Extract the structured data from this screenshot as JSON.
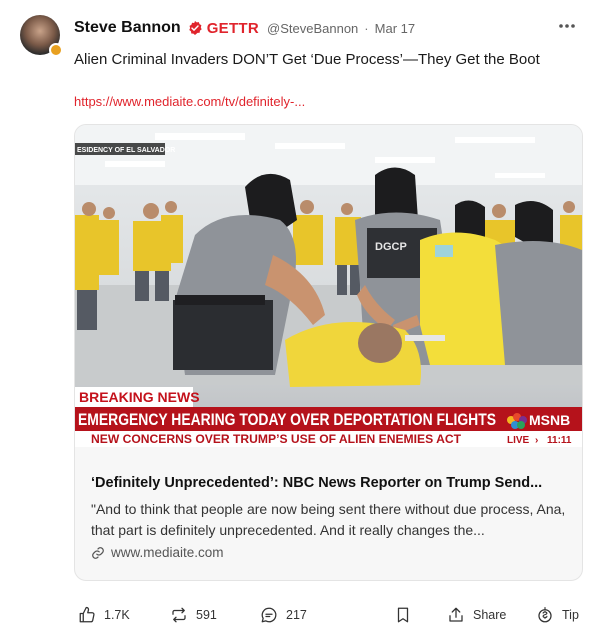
{
  "post": {
    "author": {
      "display_name": "Steve Bannon",
      "brand": "GETTR",
      "handle": "@SteveBannon",
      "separator": "·",
      "time": "Mar 17",
      "verified_icon": "verified-badge-icon"
    },
    "text": "Alien Criminal Invaders DON’T Get ‘Due Process’—They Get the Boot",
    "link": "https://www.mediaite.com/tv/definitely-..."
  },
  "card": {
    "image": {
      "broadcast_label": "ESIDENCY OF EL SALVADOR",
      "vest_text": "DGCP",
      "breaking": "BREAKING NEWS",
      "headline": "EMERGENCY HEARING TODAY OVER DEPORTATION FLIGHTS",
      "subheadline": "NEW CONCERNS OVER TRUMP’S USE OF ALIEN ENEMIES ACT",
      "network": "MSNB",
      "live": "LIVE",
      "arrow": "›",
      "clock": "11:11"
    },
    "title": "‘Definitely Unprecedented’: NBC News Reporter on Trump Send...",
    "description": "\"And to think that people are now being sent there without due process, Ana, that part is definitely unprecedented. And it really changes the...",
    "domain": "www.mediaite.com",
    "domain_icon": "link-icon"
  },
  "actions": {
    "like": {
      "count": "1.7K",
      "icon": "thumbs-up-icon"
    },
    "repost": {
      "count": "591",
      "icon": "repost-icon"
    },
    "comment": {
      "count": "217",
      "icon": "comment-icon"
    },
    "bookmark": {
      "icon": "bookmark-icon"
    },
    "share": {
      "label": "Share",
      "icon": "share-icon"
    },
    "tip": {
      "label": "Tip",
      "icon": "tip-icon"
    }
  },
  "colors": {
    "brand_red": "#e0242c",
    "breaking_bar": "#b5121b",
    "shirt_yellow": "#f3de3a",
    "text_primary": "#1a1a1a",
    "text_secondary": "#666666"
  }
}
